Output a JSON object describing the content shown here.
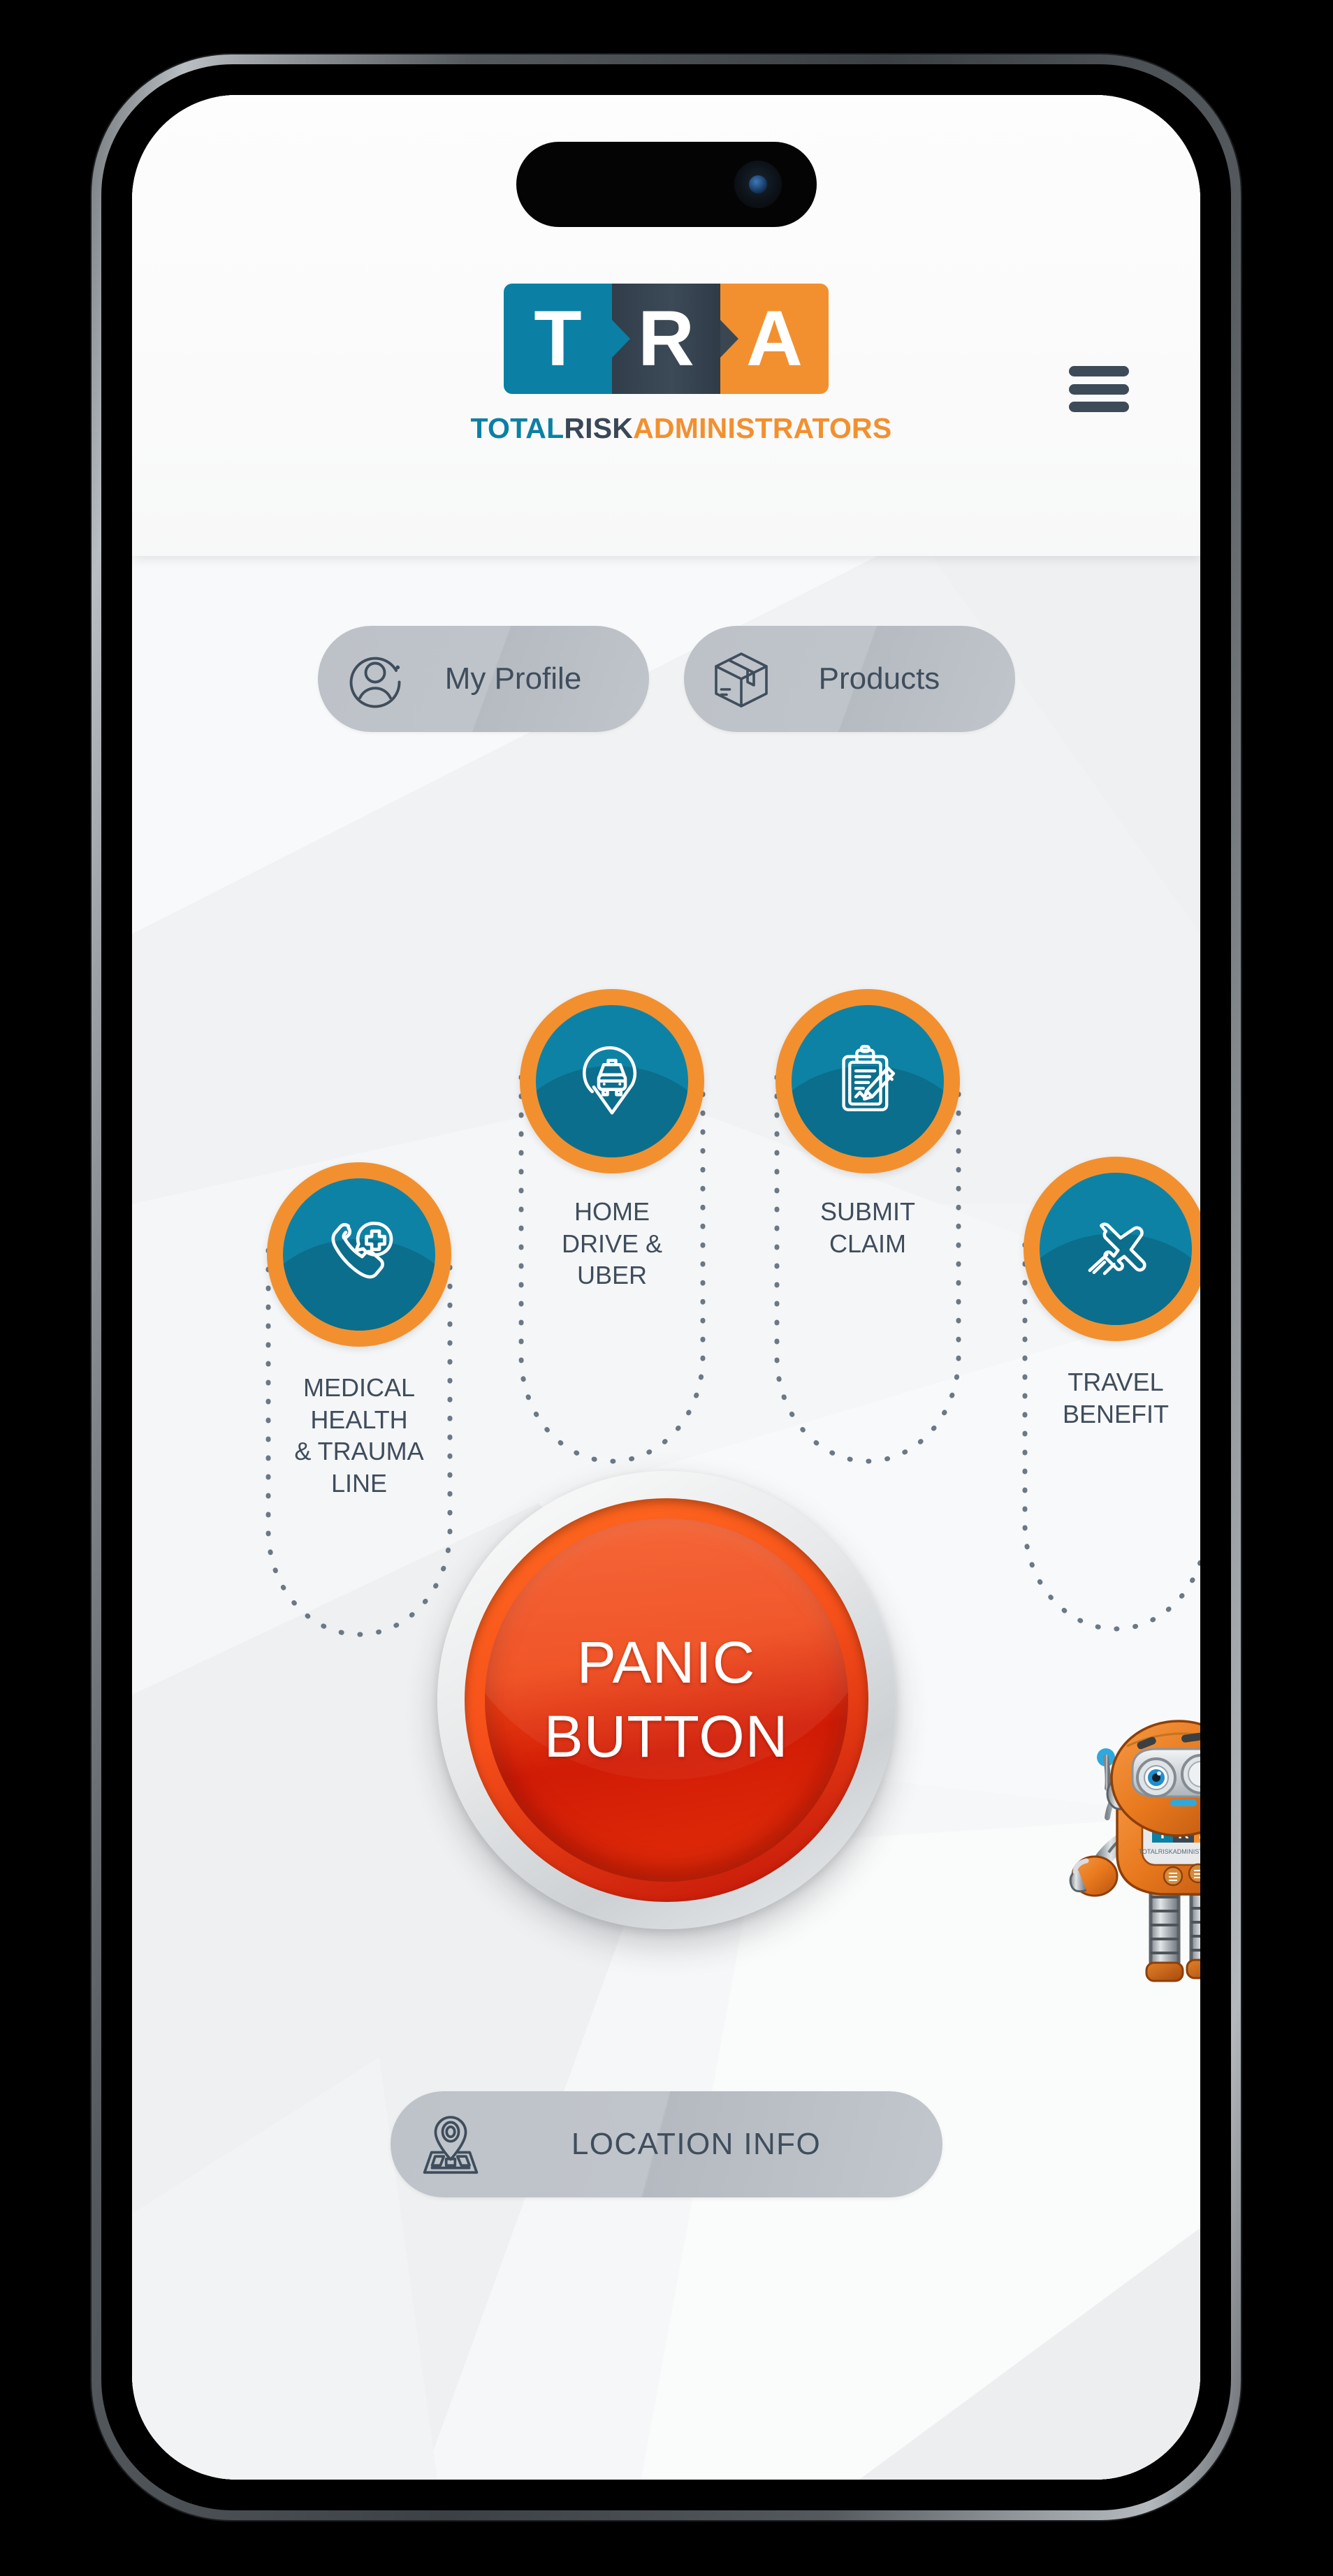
{
  "app": {
    "brand": {
      "letters": [
        "T",
        "R",
        "A"
      ],
      "tagline_total": "TOTAL",
      "tagline_risk": "RISK",
      "tagline_admin": "ADMINISTRATORS",
      "colors": {
        "teal": "#0b80a4",
        "slate": "#3a4753",
        "orange": "#f2902f",
        "text": "#3f4d5c",
        "panic_red": "#ef4716"
      }
    },
    "menu_button": "menu"
  },
  "nav": {
    "items": [
      {
        "label": "My Profile",
        "icon": "user-circle-icon"
      },
      {
        "label": "Products",
        "icon": "box-package-icon"
      }
    ]
  },
  "features": [
    {
      "id": "medical",
      "label": "MEDICAL\nHEALTH\n& TRAUMA\nLINE",
      "icon": "phone-medical-cross-icon"
    },
    {
      "id": "home",
      "label": "HOME\nDRIVE &\nUBER",
      "icon": "taxi-map-pin-icon"
    },
    {
      "id": "claim",
      "label": "SUBMIT\nCLAIM",
      "icon": "clipboard-pencil-icon"
    },
    {
      "id": "travel",
      "label": "TRAVEL\nBENEFIT",
      "icon": "airplane-icon"
    }
  ],
  "panic": {
    "line1": "PANIC",
    "line2": "BUTTON"
  },
  "location": {
    "label": "LOCATION INFO",
    "icon": "map-pin-location-icon"
  },
  "mascot": {
    "name": "tra-robot-mascot",
    "chest_badge": "TRA",
    "chest_sub": "TOTALRISKADMINISTRATORS"
  }
}
